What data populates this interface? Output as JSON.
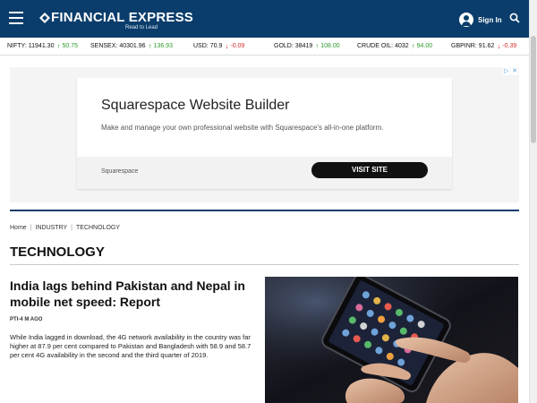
{
  "header": {
    "logo_text": "FINANCIAL EXPRESS",
    "logo_tagline": "Read to Lead",
    "signin_label": "Sign In",
    "colors": {
      "brand": "#0a3d6b"
    }
  },
  "ticker": [
    {
      "label": "NIFTY:",
      "value": "11941.30",
      "change": "50.75",
      "direction": "up"
    },
    {
      "label": "SENSEX:",
      "value": "40301.96",
      "change": "136.93",
      "direction": "up"
    },
    {
      "label": "USD:",
      "value": "70.9",
      "change": "-0.09",
      "direction": "down"
    },
    {
      "label": "GOLD:",
      "value": "38419",
      "change": "108.00",
      "direction": "up"
    },
    {
      "label": "CRUDE OIL:",
      "value": "4032",
      "change": "94.00",
      "direction": "up"
    },
    {
      "label": "GBPINR:",
      "value": "91.62",
      "change": "-0.39",
      "direction": "down"
    }
  ],
  "ad": {
    "title": "Squarespace Website Builder",
    "description": "Make and manage your own professional website with Squarespace's all-in-one platform.",
    "brand": "Squarespace",
    "cta": "VISIT SITE"
  },
  "breadcrumb": [
    "Home",
    "INDUSTRY",
    "TECHNOLOGY"
  ],
  "section_title": "TECHNOLOGY",
  "article": {
    "headline": "India lags behind Pakistan and Nepal in mobile net speed: Report",
    "byline": "PTI-4 M AGO",
    "summary": "While India lagged in download, the 4G network availability in the country was far higher at 87.9 per cent compared to Pakistan and Bangladesh with 58.9 and 58.7 per cent 4G availability in the second and the third quarter of 2019."
  }
}
